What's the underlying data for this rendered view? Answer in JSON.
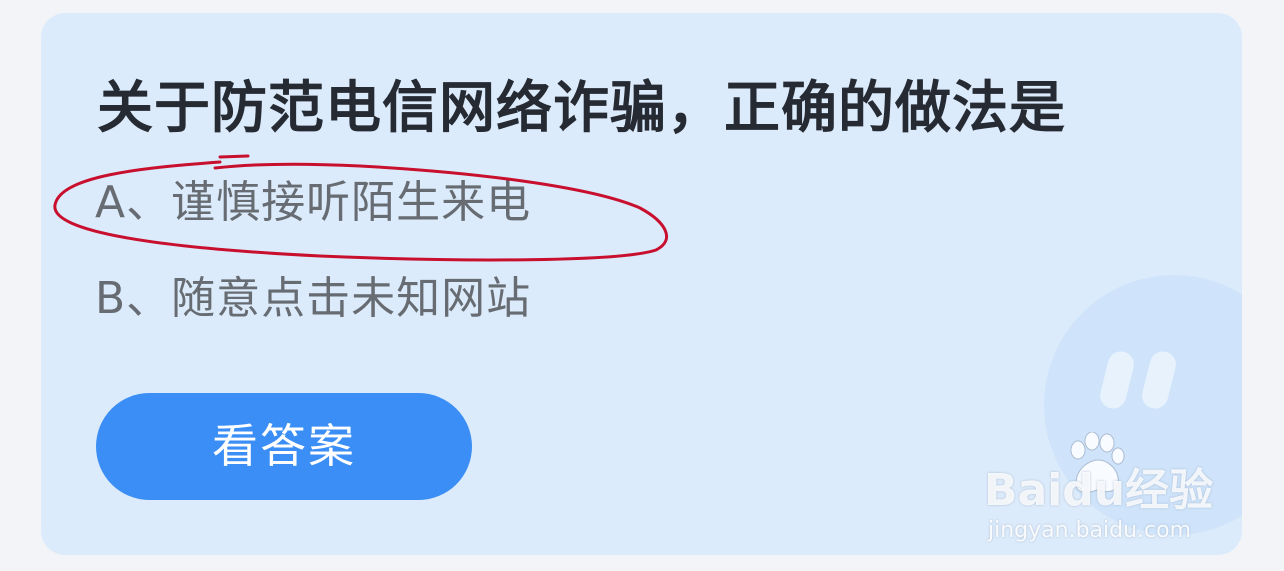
{
  "quiz": {
    "question": "关于防范电信网络诈骗，正确的做法是",
    "options": [
      {
        "label": "A、谨慎接听陌生来电",
        "circled": true
      },
      {
        "label": "B、随意点击未知网站",
        "circled": false
      }
    ],
    "answer_button": "看答案"
  },
  "watermark": {
    "brand": "Baidu经验",
    "url": "jingyan.baidu.com"
  },
  "colors": {
    "card_background": "#dcebfb",
    "button": "#3a8ef5",
    "annotation_stroke": "#c8102e"
  }
}
